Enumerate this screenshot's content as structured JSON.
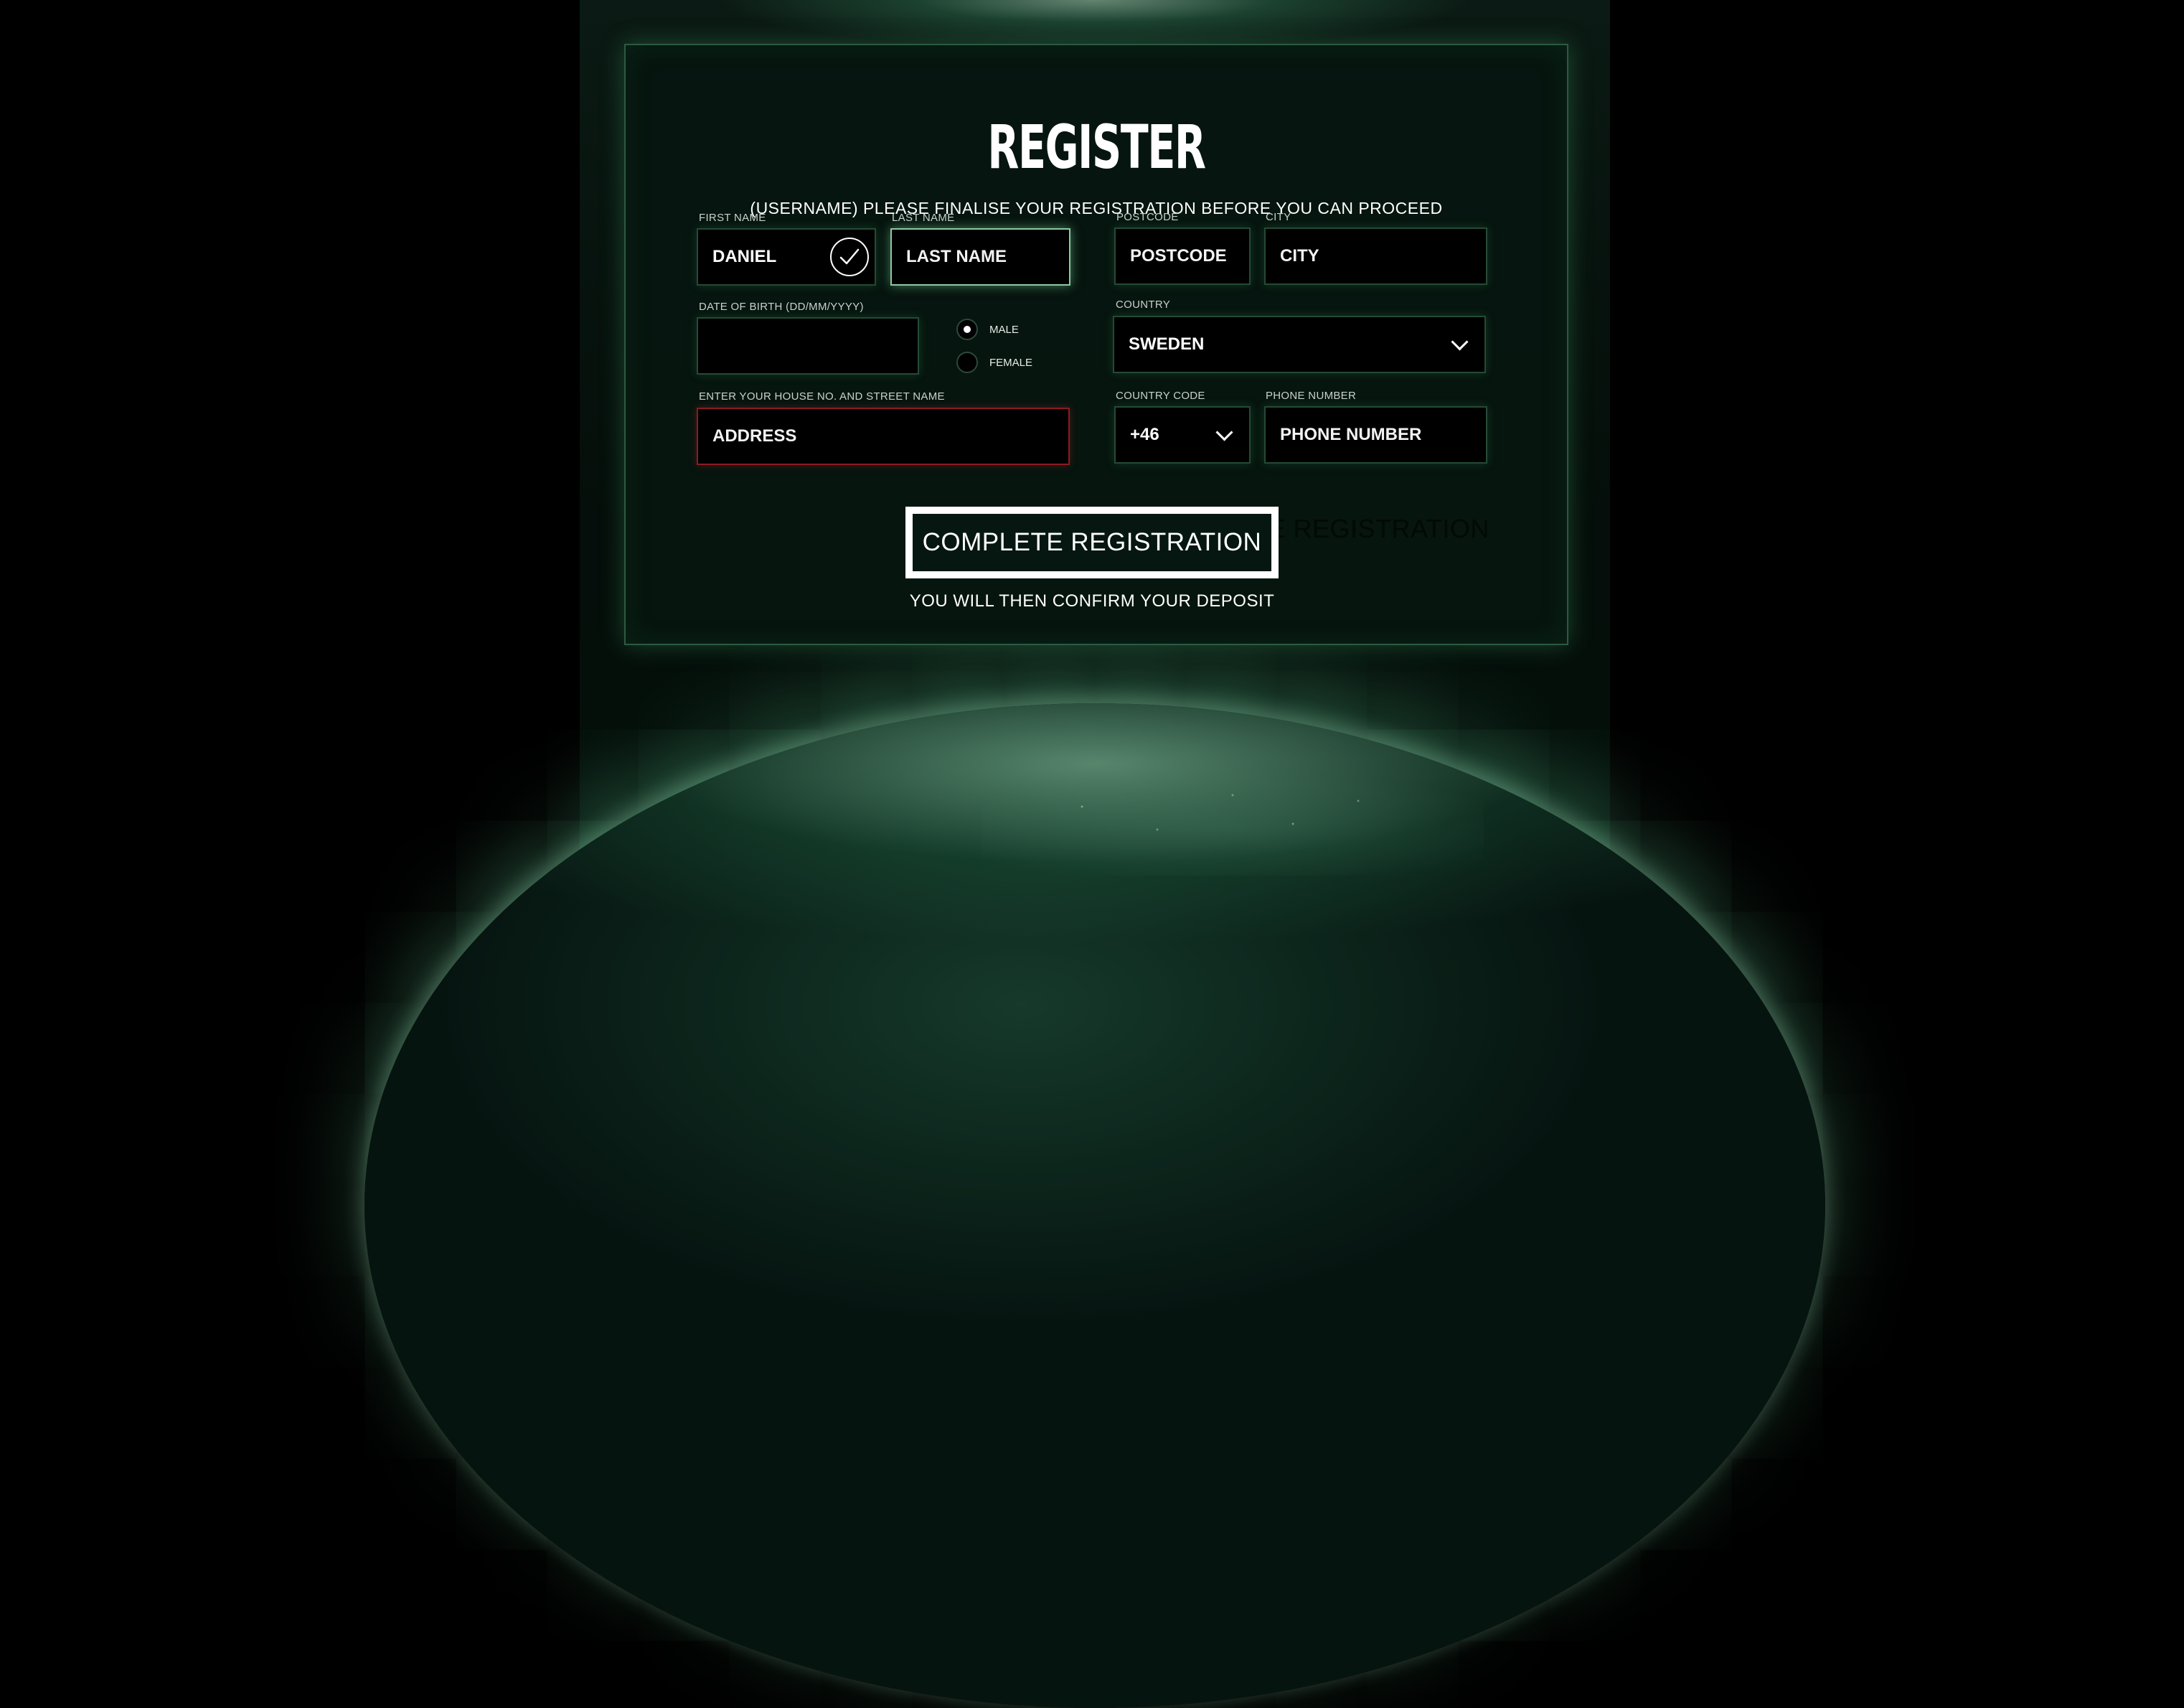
{
  "page": {
    "title": "REGISTER",
    "subtitle": "(USERNAME) PLEASE FINALISE YOUR REGISTRATION BEFORE YOU CAN PROCEED"
  },
  "form": {
    "first_name": {
      "label": "FIRST NAME",
      "value": "DANIEL",
      "validated": true
    },
    "last_name": {
      "label": "LAST NAME",
      "placeholder": "LAST NAME"
    },
    "postcode": {
      "label": "POSTCODE",
      "placeholder": "POSTCODE"
    },
    "city": {
      "label": "CITY",
      "placeholder": "CITY"
    },
    "dob": {
      "label": "DATE OF BIRTH (DD/MM/YYYY)",
      "value": ""
    },
    "gender": {
      "options": [
        {
          "label": "MALE",
          "selected": true
        },
        {
          "label": "FEMALE",
          "selected": false
        }
      ]
    },
    "country": {
      "label": "COUNTRY",
      "selected": "SWEDEN"
    },
    "address": {
      "label": "ENTER YOUR HOUSE NO. AND STREET NAME",
      "placeholder": "ADDRESS",
      "state": "error"
    },
    "country_code": {
      "label": "COUNTRY CODE",
      "selected": "+46"
    },
    "phone": {
      "label": "PHONE NUMBER",
      "placeholder": "PHONE NUMBER"
    }
  },
  "cta": {
    "label": "COMPLETE REGISTRATION",
    "ghost_label": "COMPLETE REGISTRATION",
    "note": "YOU WILL THEN CONFIRM YOUR DEPOSIT"
  },
  "theme": {
    "accent_border": "#2c5a40",
    "focus_border": "#8fc7a4",
    "error_border": "#8a1c22",
    "background": "#000000"
  },
  "icons": {
    "validated": "check-circle-icon",
    "dropdown": "chevron-down-icon",
    "radio_selected": "radio-selected-icon"
  }
}
